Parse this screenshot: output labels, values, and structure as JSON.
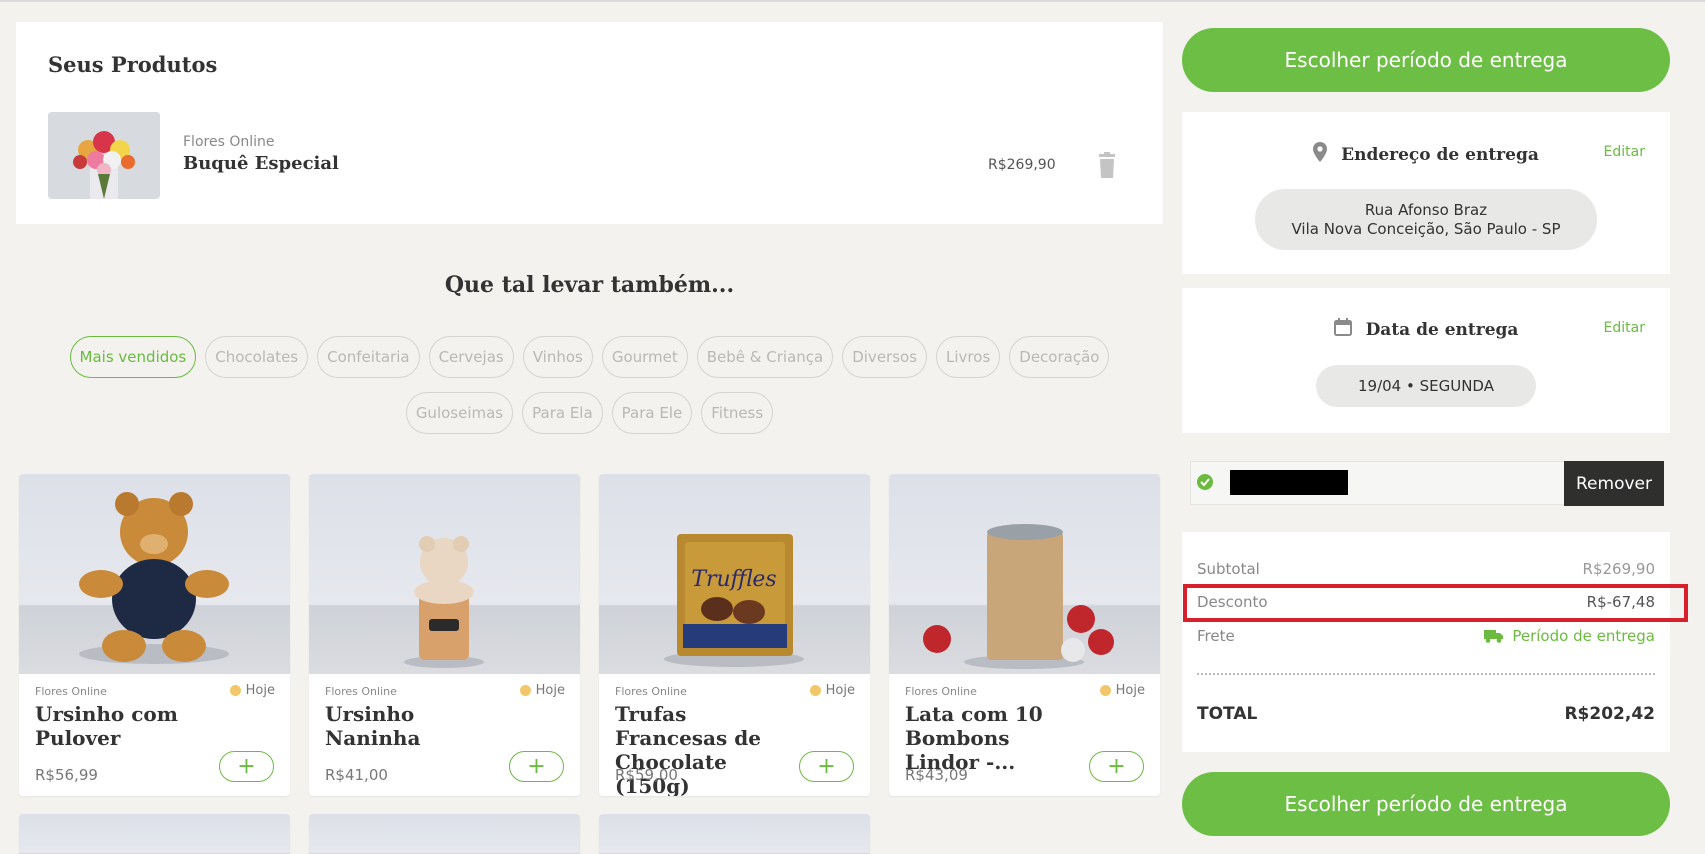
{
  "cart": {
    "title": "Seus Produtos",
    "item": {
      "brand": "Flores Online",
      "name": "Buquê Especial",
      "price": "R$269,90"
    }
  },
  "suggestions": {
    "title": "Que tal levar também...",
    "chips": [
      "Mais vendidos",
      "Chocolates",
      "Confeitaria",
      "Cervejas",
      "Vinhos",
      "Gourmet",
      "Bebê & Criança",
      "Diversos",
      "Livros",
      "Decoração",
      "Guloseimas",
      "Para Ela",
      "Para Ele",
      "Fitness"
    ],
    "active_chip": "Mais vendidos",
    "products": [
      {
        "brand": "Flores Online",
        "today": "Hoje",
        "name": "Ursinho com Pulover",
        "price": "R$56,99",
        "icon": "teddy-bear"
      },
      {
        "brand": "Flores Online",
        "today": "Hoje",
        "name": "Ursinho Naninha",
        "price": "R$41,00",
        "icon": "plush-jar"
      },
      {
        "brand": "Flores Online",
        "today": "Hoje",
        "name": "Trufas Francesas de Chocolate (150g)",
        "price": "R$59,00",
        "icon": "truffle-box"
      },
      {
        "brand": "Flores Online",
        "today": "Hoje",
        "name": "Lata com 10 Bombons Lindor -...",
        "price": "R$43,09",
        "icon": "chocolate-tin"
      }
    ]
  },
  "sidebar": {
    "cta_label": "Escolher período de entrega",
    "address": {
      "title": "Endereço de entrega",
      "edit": "Editar",
      "line1": "Rua Afonso Braz",
      "line2": "Vila Nova Conceição, São Paulo - SP"
    },
    "date": {
      "title": "Data de entrega",
      "edit": "Editar",
      "value": "19/04  •  SEGUNDA"
    },
    "coupon": {
      "remove_label": "Remover"
    },
    "summary": {
      "subtotal_label": "Subtotal",
      "subtotal_value": "R$269,90",
      "discount_label": "Desconto",
      "discount_value": "R$-67,48",
      "freight_label": "Frete",
      "freight_value": "Período de entrega",
      "total_label": "TOTAL",
      "total_value": "R$202,42"
    }
  },
  "colors": {
    "accent": "#6dbe45",
    "highlight": "#d8202c",
    "dark_button": "#2f2f2e"
  }
}
